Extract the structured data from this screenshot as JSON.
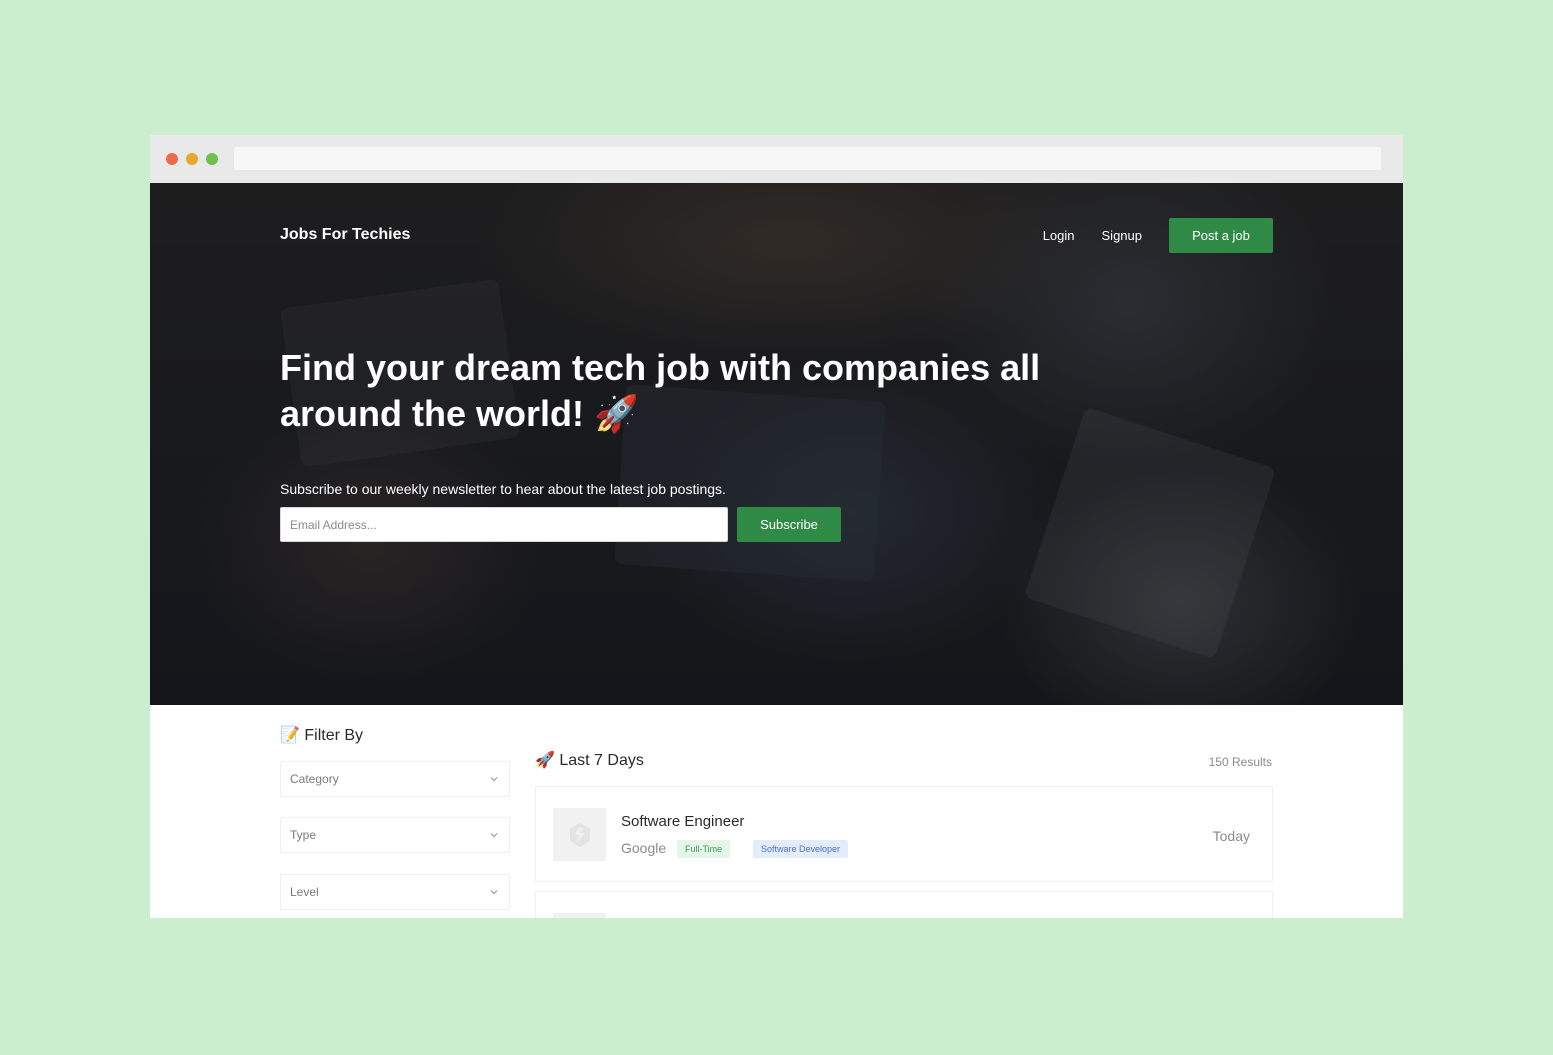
{
  "colors": {
    "background": "#cbeecf",
    "accent": "#2f8a46",
    "traffic_red": "#ee6a4d",
    "traffic_yellow": "#e6a92f",
    "traffic_green": "#6cc24a"
  },
  "nav": {
    "brand": "Jobs For Techies",
    "login": "Login",
    "signup": "Signup",
    "post_job": "Post a job"
  },
  "hero": {
    "headline": "Find your dream tech job with companies all around the world! 🚀",
    "newsletter_text": "Subscribe to our weekly newsletter to hear about the latest job postings.",
    "email_placeholder": "Email Address...",
    "subscribe_label": "Subscribe"
  },
  "filters": {
    "title": "📝 Filter By",
    "selects": [
      {
        "label": "Category",
        "icon": "chevron-down-icon"
      },
      {
        "label": "Type",
        "icon": "chevron-down-icon"
      },
      {
        "label": "Level",
        "icon": "chevron-down-icon"
      }
    ]
  },
  "results": {
    "title": "🚀 Last 7 Days",
    "count": "150 Results",
    "jobs": [
      {
        "title": "Software Engineer",
        "company": "Google",
        "type": "Full-Time",
        "category": "Software Developer",
        "date": "Today",
        "logo_icon": "company-logo-icon"
      }
    ]
  }
}
